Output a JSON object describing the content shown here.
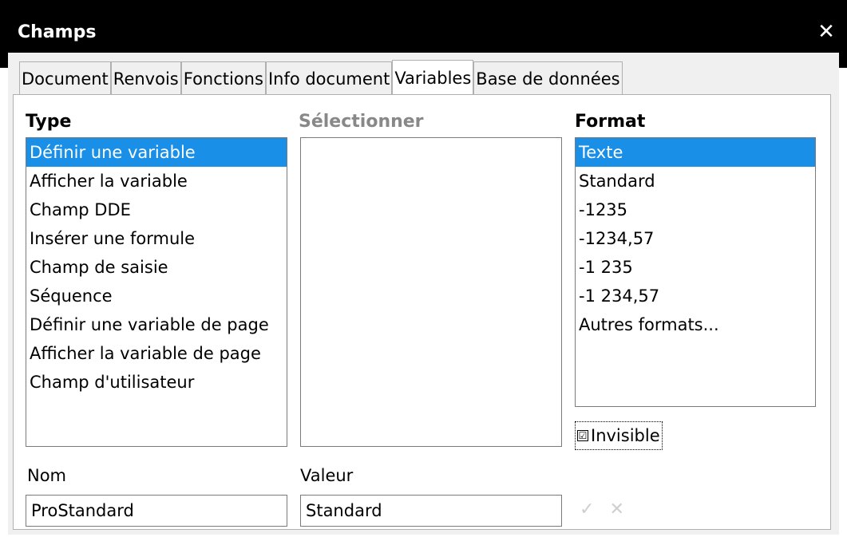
{
  "window": {
    "title": "Champs",
    "close_icon": "close-icon"
  },
  "tabs": [
    {
      "label": "Document"
    },
    {
      "label": "Renvois"
    },
    {
      "label": "Fonctions"
    },
    {
      "label": "Info document"
    },
    {
      "label": "Variables",
      "active": true
    },
    {
      "label": "Base de données"
    }
  ],
  "type_section": {
    "heading": "Type",
    "items": [
      "Définir une variable",
      "Afficher la variable",
      "Champ DDE",
      "Insérer une formule",
      "Champ de saisie",
      "Séquence",
      "Définir une variable de page",
      "Afficher la variable de page",
      "Champ d'utilisateur"
    ],
    "selected_index": 0
  },
  "select_section": {
    "heading": "Sélectionner",
    "items": []
  },
  "format_section": {
    "heading": "Format",
    "items": [
      "Texte",
      "Standard",
      "-1235",
      "-1234,57",
      "-1 235",
      "-1 234,57",
      "Autres formats..."
    ],
    "selected_index": 0
  },
  "invisible_checkbox": {
    "label": "Invisible",
    "checked": true,
    "check_glyph": "☑"
  },
  "name_field": {
    "label": "Nom",
    "value": "ProStandard"
  },
  "value_field": {
    "label": "Valeur",
    "value": "Standard"
  },
  "action_icons": {
    "apply": "✓",
    "cancel": "✕"
  },
  "colors": {
    "selection": "#1a8fe8",
    "titlebar": "#000000",
    "disabled_text": "#888888"
  }
}
